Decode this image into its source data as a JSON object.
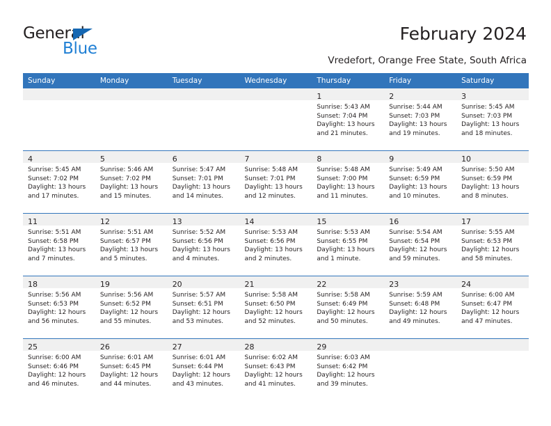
{
  "brand": {
    "name_top": "General",
    "name_bottom": "Blue",
    "triangle_icon": "triangle-icon",
    "color_dark": "#231f20",
    "color_blue": "#1f7fd4"
  },
  "header": {
    "title": "February 2024",
    "subtitle": "Vredefort, Orange Free State, South Africa"
  },
  "theme": {
    "header_bg": "#3275bb",
    "header_text": "#ffffff",
    "daynum_band": "#f0f0f0",
    "grid_line": "#3275bb"
  },
  "calendar": {
    "weekday_headers": [
      "Sunday",
      "Monday",
      "Tuesday",
      "Wednesday",
      "Thursday",
      "Friday",
      "Saturday"
    ],
    "weeks": [
      [
        {
          "empty": true
        },
        {
          "empty": true
        },
        {
          "empty": true
        },
        {
          "empty": true
        },
        {
          "empty": false,
          "day": "1",
          "sunrise": "Sunrise: 5:43 AM",
          "sunset": "Sunset: 7:04 PM",
          "daylight_line1": "Daylight: 13 hours",
          "daylight_line2": "and 21 minutes."
        },
        {
          "empty": false,
          "day": "2",
          "sunrise": "Sunrise: 5:44 AM",
          "sunset": "Sunset: 7:03 PM",
          "daylight_line1": "Daylight: 13 hours",
          "daylight_line2": "and 19 minutes."
        },
        {
          "empty": false,
          "day": "3",
          "sunrise": "Sunrise: 5:45 AM",
          "sunset": "Sunset: 7:03 PM",
          "daylight_line1": "Daylight: 13 hours",
          "daylight_line2": "and 18 minutes."
        }
      ],
      [
        {
          "empty": false,
          "day": "4",
          "sunrise": "Sunrise: 5:45 AM",
          "sunset": "Sunset: 7:02 PM",
          "daylight_line1": "Daylight: 13 hours",
          "daylight_line2": "and 17 minutes."
        },
        {
          "empty": false,
          "day": "5",
          "sunrise": "Sunrise: 5:46 AM",
          "sunset": "Sunset: 7:02 PM",
          "daylight_line1": "Daylight: 13 hours",
          "daylight_line2": "and 15 minutes."
        },
        {
          "empty": false,
          "day": "6",
          "sunrise": "Sunrise: 5:47 AM",
          "sunset": "Sunset: 7:01 PM",
          "daylight_line1": "Daylight: 13 hours",
          "daylight_line2": "and 14 minutes."
        },
        {
          "empty": false,
          "day": "7",
          "sunrise": "Sunrise: 5:48 AM",
          "sunset": "Sunset: 7:01 PM",
          "daylight_line1": "Daylight: 13 hours",
          "daylight_line2": "and 12 minutes."
        },
        {
          "empty": false,
          "day": "8",
          "sunrise": "Sunrise: 5:48 AM",
          "sunset": "Sunset: 7:00 PM",
          "daylight_line1": "Daylight: 13 hours",
          "daylight_line2": "and 11 minutes."
        },
        {
          "empty": false,
          "day": "9",
          "sunrise": "Sunrise: 5:49 AM",
          "sunset": "Sunset: 6:59 PM",
          "daylight_line1": "Daylight: 13 hours",
          "daylight_line2": "and 10 minutes."
        },
        {
          "empty": false,
          "day": "10",
          "sunrise": "Sunrise: 5:50 AM",
          "sunset": "Sunset: 6:59 PM",
          "daylight_line1": "Daylight: 13 hours",
          "daylight_line2": "and 8 minutes."
        }
      ],
      [
        {
          "empty": false,
          "day": "11",
          "sunrise": "Sunrise: 5:51 AM",
          "sunset": "Sunset: 6:58 PM",
          "daylight_line1": "Daylight: 13 hours",
          "daylight_line2": "and 7 minutes."
        },
        {
          "empty": false,
          "day": "12",
          "sunrise": "Sunrise: 5:51 AM",
          "sunset": "Sunset: 6:57 PM",
          "daylight_line1": "Daylight: 13 hours",
          "daylight_line2": "and 5 minutes."
        },
        {
          "empty": false,
          "day": "13",
          "sunrise": "Sunrise: 5:52 AM",
          "sunset": "Sunset: 6:56 PM",
          "daylight_line1": "Daylight: 13 hours",
          "daylight_line2": "and 4 minutes."
        },
        {
          "empty": false,
          "day": "14",
          "sunrise": "Sunrise: 5:53 AM",
          "sunset": "Sunset: 6:56 PM",
          "daylight_line1": "Daylight: 13 hours",
          "daylight_line2": "and 2 minutes."
        },
        {
          "empty": false,
          "day": "15",
          "sunrise": "Sunrise: 5:53 AM",
          "sunset": "Sunset: 6:55 PM",
          "daylight_line1": "Daylight: 13 hours",
          "daylight_line2": "and 1 minute."
        },
        {
          "empty": false,
          "day": "16",
          "sunrise": "Sunrise: 5:54 AM",
          "sunset": "Sunset: 6:54 PM",
          "daylight_line1": "Daylight: 12 hours",
          "daylight_line2": "and 59 minutes."
        },
        {
          "empty": false,
          "day": "17",
          "sunrise": "Sunrise: 5:55 AM",
          "sunset": "Sunset: 6:53 PM",
          "daylight_line1": "Daylight: 12 hours",
          "daylight_line2": "and 58 minutes."
        }
      ],
      [
        {
          "empty": false,
          "day": "18",
          "sunrise": "Sunrise: 5:56 AM",
          "sunset": "Sunset: 6:53 PM",
          "daylight_line1": "Daylight: 12 hours",
          "daylight_line2": "and 56 minutes."
        },
        {
          "empty": false,
          "day": "19",
          "sunrise": "Sunrise: 5:56 AM",
          "sunset": "Sunset: 6:52 PM",
          "daylight_line1": "Daylight: 12 hours",
          "daylight_line2": "and 55 minutes."
        },
        {
          "empty": false,
          "day": "20",
          "sunrise": "Sunrise: 5:57 AM",
          "sunset": "Sunset: 6:51 PM",
          "daylight_line1": "Daylight: 12 hours",
          "daylight_line2": "and 53 minutes."
        },
        {
          "empty": false,
          "day": "21",
          "sunrise": "Sunrise: 5:58 AM",
          "sunset": "Sunset: 6:50 PM",
          "daylight_line1": "Daylight: 12 hours",
          "daylight_line2": "and 52 minutes."
        },
        {
          "empty": false,
          "day": "22",
          "sunrise": "Sunrise: 5:58 AM",
          "sunset": "Sunset: 6:49 PM",
          "daylight_line1": "Daylight: 12 hours",
          "daylight_line2": "and 50 minutes."
        },
        {
          "empty": false,
          "day": "23",
          "sunrise": "Sunrise: 5:59 AM",
          "sunset": "Sunset: 6:48 PM",
          "daylight_line1": "Daylight: 12 hours",
          "daylight_line2": "and 49 minutes."
        },
        {
          "empty": false,
          "day": "24",
          "sunrise": "Sunrise: 6:00 AM",
          "sunset": "Sunset: 6:47 PM",
          "daylight_line1": "Daylight: 12 hours",
          "daylight_line2": "and 47 minutes."
        }
      ],
      [
        {
          "empty": false,
          "day": "25",
          "sunrise": "Sunrise: 6:00 AM",
          "sunset": "Sunset: 6:46 PM",
          "daylight_line1": "Daylight: 12 hours",
          "daylight_line2": "and 46 minutes."
        },
        {
          "empty": false,
          "day": "26",
          "sunrise": "Sunrise: 6:01 AM",
          "sunset": "Sunset: 6:45 PM",
          "daylight_line1": "Daylight: 12 hours",
          "daylight_line2": "and 44 minutes."
        },
        {
          "empty": false,
          "day": "27",
          "sunrise": "Sunrise: 6:01 AM",
          "sunset": "Sunset: 6:44 PM",
          "daylight_line1": "Daylight: 12 hours",
          "daylight_line2": "and 43 minutes."
        },
        {
          "empty": false,
          "day": "28",
          "sunrise": "Sunrise: 6:02 AM",
          "sunset": "Sunset: 6:43 PM",
          "daylight_line1": "Daylight: 12 hours",
          "daylight_line2": "and 41 minutes."
        },
        {
          "empty": false,
          "day": "29",
          "sunrise": "Sunrise: 6:03 AM",
          "sunset": "Sunset: 6:42 PM",
          "daylight_line1": "Daylight: 12 hours",
          "daylight_line2": "and 39 minutes."
        },
        {
          "empty": true
        },
        {
          "empty": true
        }
      ]
    ]
  }
}
